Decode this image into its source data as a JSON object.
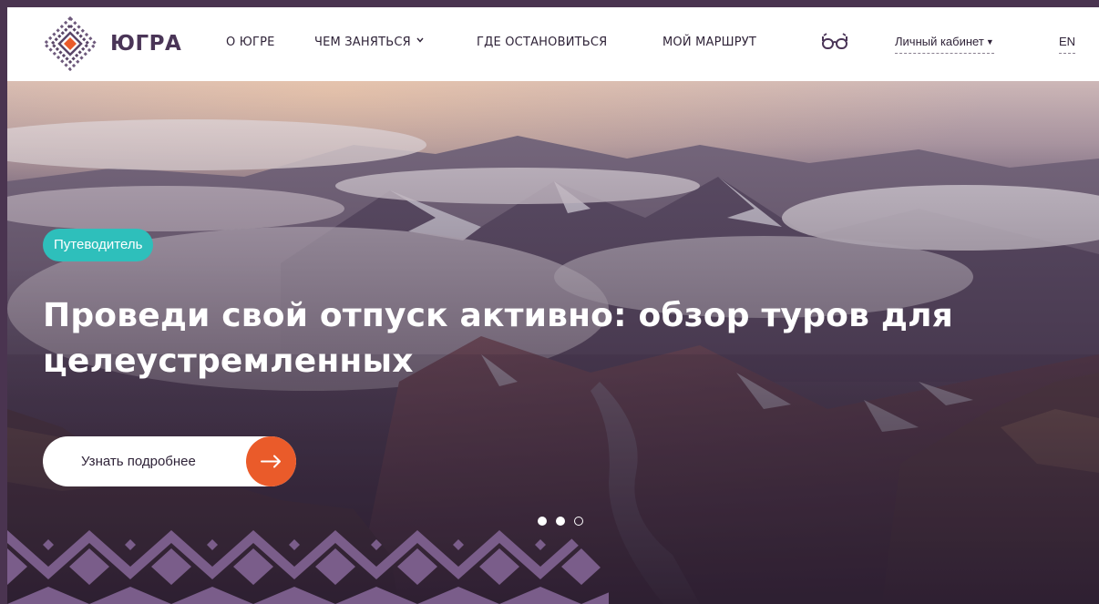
{
  "header": {
    "logo_text": "ЮГРА",
    "nav": [
      {
        "label": "О ЮГРЕ"
      },
      {
        "label": "ЧЕМ ЗАНЯТЬСЯ"
      },
      {
        "label": "ГДЕ ОСТАНОВИТЬСЯ"
      },
      {
        "label": "МОЙ МАРШРУТ"
      }
    ],
    "accessibility_icon": "glasses-icon",
    "account_label": "Личный кабинет",
    "language": "EN"
  },
  "hero": {
    "tag": "Путеводитель",
    "title": "Проведи свой отпуск активно: обзор туров для целеустремленных",
    "cta_label": "Узнать подробнее",
    "slider": {
      "total": 3,
      "active": 3
    }
  },
  "colors": {
    "brand": "#4a3557",
    "accent_orange": "#ea5b2a",
    "tag_teal": "#2ebfbb",
    "ornament": "#7a5d8a"
  }
}
